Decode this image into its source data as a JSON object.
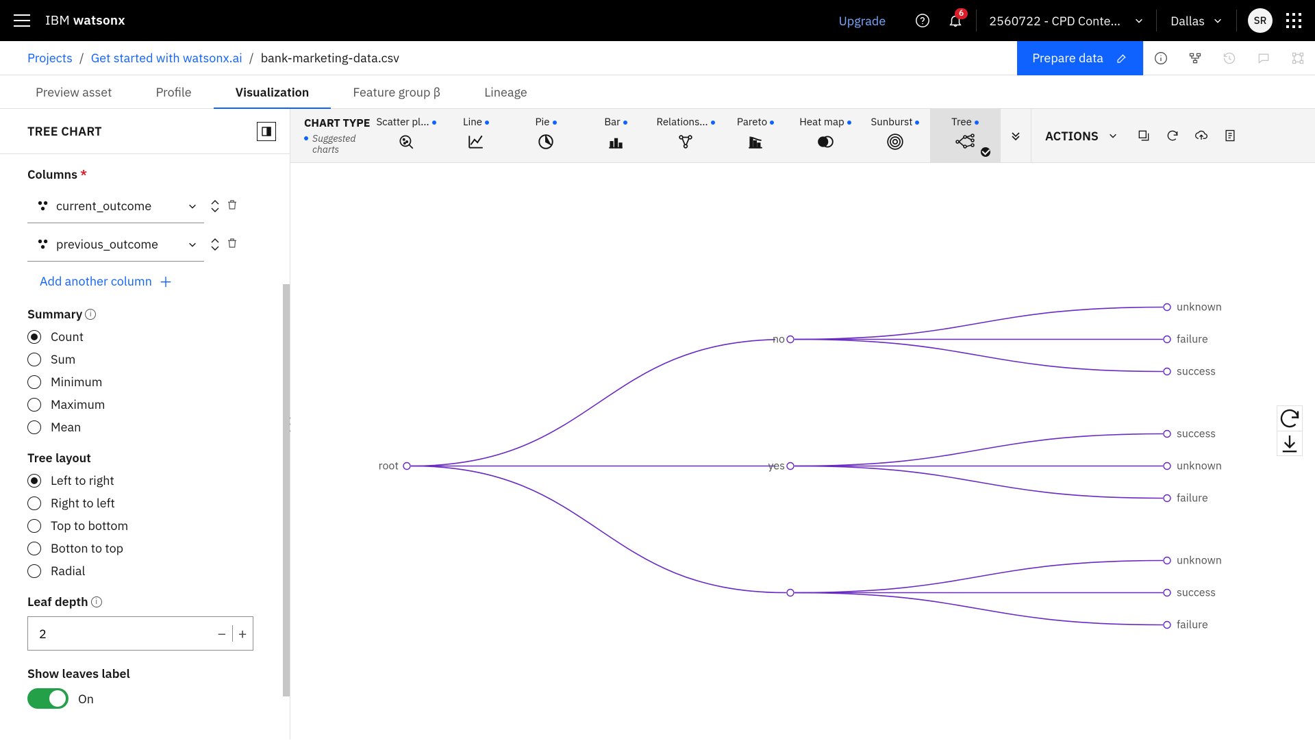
{
  "header": {
    "brand_prefix": "IBM ",
    "brand_bold": "watsonx",
    "upgrade": "Upgrade",
    "notifications_badge": "6",
    "account": "2560722 - CPD Content De...",
    "region": "Dallas",
    "avatar_initials": "SR"
  },
  "breadcrumb": {
    "root": "Projects",
    "project": "Get started with watsonx.ai",
    "asset": "bank-marketing-data.csv",
    "prepare_btn": "Prepare data"
  },
  "tabs": [
    "Preview asset",
    "Profile",
    "Visualization",
    "Feature group β",
    "Lineage"
  ],
  "active_tab": 2,
  "panel": {
    "title": "TREE CHART",
    "columns_label": "Columns",
    "columns": [
      "current_outcome",
      "previous_outcome"
    ],
    "add_column": "Add another column",
    "summary_label": "Summary",
    "summary_options": [
      "Count",
      "Sum",
      "Minimum",
      "Maximum",
      "Mean"
    ],
    "summary_selected": 0,
    "layout_label": "Tree layout",
    "layout_options": [
      "Left to right",
      "Right to left",
      "Top to bottom",
      "Botton to top",
      "Radial"
    ],
    "layout_selected": 0,
    "leaf_depth_label": "Leaf depth",
    "leaf_depth_value": "2",
    "show_leaves_label": "Show leaves label",
    "toggle_state": "On"
  },
  "chart_strip": {
    "label": "CHART TYPE",
    "sublabel": "Suggested charts",
    "types": [
      "Scatter pl...",
      "Line",
      "Pie",
      "Bar",
      "Relations...",
      "Pareto",
      "Heat map",
      "Sunburst",
      "Tree"
    ],
    "active": 8,
    "actions_label": "ACTIONS"
  },
  "chart_data": {
    "type": "tree",
    "root": "root",
    "children": [
      {
        "name": "no",
        "children": [
          "unknown",
          "failure",
          "success"
        ]
      },
      {
        "name": "yes",
        "children": [
          "success",
          "unknown",
          "failure"
        ]
      },
      {
        "name": "",
        "children": [
          "unknown",
          "success",
          "failure"
        ]
      }
    ]
  }
}
